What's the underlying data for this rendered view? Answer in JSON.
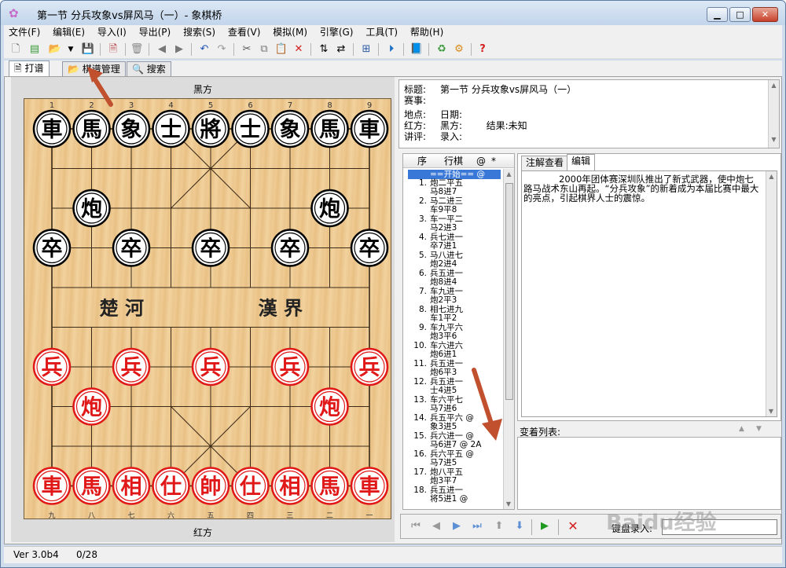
{
  "window": {
    "title": "第一节  分兵攻象vs屏风马（一）- 象棋桥",
    "minimize": "▁",
    "maximize": "□",
    "close": "✕"
  },
  "menu": [
    "文件(F)",
    "编辑(E)",
    "导入(I)",
    "导出(P)",
    "搜索(S)",
    "查看(V)",
    "模拟(M)",
    "引擎(G)",
    "工具(T)",
    "帮助(H)"
  ],
  "tabs": [
    {
      "label": "打谱",
      "icon": "notepad-icon"
    },
    {
      "label": "棋谱管理",
      "icon": "folder-icon"
    },
    {
      "label": "搜索",
      "icon": "magnifier-icon"
    }
  ],
  "board": {
    "top_label": "黑方",
    "bottom_label": "红方",
    "top_files": [
      "1",
      "2",
      "3",
      "4",
      "5",
      "6",
      "7",
      "8",
      "9"
    ],
    "bottom_files": [
      "九",
      "八",
      "七",
      "六",
      "五",
      "四",
      "三",
      "二",
      "一"
    ],
    "river_left": "楚  河",
    "river_right": "漢  界",
    "pieces": [
      {
        "c": "b",
        "t": "車",
        "f": 0,
        "r": 0
      },
      {
        "c": "b",
        "t": "馬",
        "f": 1,
        "r": 0
      },
      {
        "c": "b",
        "t": "象",
        "f": 2,
        "r": 0
      },
      {
        "c": "b",
        "t": "士",
        "f": 3,
        "r": 0
      },
      {
        "c": "b",
        "t": "將",
        "f": 4,
        "r": 0
      },
      {
        "c": "b",
        "t": "士",
        "f": 5,
        "r": 0
      },
      {
        "c": "b",
        "t": "象",
        "f": 6,
        "r": 0
      },
      {
        "c": "b",
        "t": "馬",
        "f": 7,
        "r": 0
      },
      {
        "c": "b",
        "t": "車",
        "f": 8,
        "r": 0
      },
      {
        "c": "b",
        "t": "炮",
        "f": 1,
        "r": 2
      },
      {
        "c": "b",
        "t": "炮",
        "f": 7,
        "r": 2
      },
      {
        "c": "b",
        "t": "卒",
        "f": 0,
        "r": 3
      },
      {
        "c": "b",
        "t": "卒",
        "f": 2,
        "r": 3
      },
      {
        "c": "b",
        "t": "卒",
        "f": 4,
        "r": 3
      },
      {
        "c": "b",
        "t": "卒",
        "f": 6,
        "r": 3
      },
      {
        "c": "b",
        "t": "卒",
        "f": 8,
        "r": 3
      },
      {
        "c": "r",
        "t": "兵",
        "f": 0,
        "r": 6
      },
      {
        "c": "r",
        "t": "兵",
        "f": 2,
        "r": 6
      },
      {
        "c": "r",
        "t": "兵",
        "f": 4,
        "r": 6
      },
      {
        "c": "r",
        "t": "兵",
        "f": 6,
        "r": 6
      },
      {
        "c": "r",
        "t": "兵",
        "f": 8,
        "r": 6
      },
      {
        "c": "r",
        "t": "炮",
        "f": 1,
        "r": 7
      },
      {
        "c": "r",
        "t": "炮",
        "f": 7,
        "r": 7
      },
      {
        "c": "r",
        "t": "車",
        "f": 0,
        "r": 9
      },
      {
        "c": "r",
        "t": "馬",
        "f": 1,
        "r": 9
      },
      {
        "c": "r",
        "t": "相",
        "f": 2,
        "r": 9
      },
      {
        "c": "r",
        "t": "仕",
        "f": 3,
        "r": 9
      },
      {
        "c": "r",
        "t": "帥",
        "f": 4,
        "r": 9
      },
      {
        "c": "r",
        "t": "仕",
        "f": 5,
        "r": 9
      },
      {
        "c": "r",
        "t": "相",
        "f": 6,
        "r": 9
      },
      {
        "c": "r",
        "t": "馬",
        "f": 7,
        "r": 9
      },
      {
        "c": "r",
        "t": "車",
        "f": 8,
        "r": 9
      }
    ]
  },
  "info": {
    "title_label": "标题:",
    "title_value": "第一节  分兵攻象vs屏风马（一）",
    "event_label": "赛事:",
    "place_label": "地点:",
    "date_label": "日期:",
    "red_label": "红方:",
    "black_label": "黑方:",
    "result_label": "结果:",
    "result_value": "未知",
    "commentator_label": "讲评:",
    "recorder_label": "录入:"
  },
  "moves": {
    "col_seq": "序",
    "col_move": "行棋",
    "col_at": "@",
    "col_star": "*",
    "start": "==开始== @",
    "list": [
      {
        "n": "1.",
        "r": "炮二平五",
        "b": "马8进7"
      },
      {
        "n": "2.",
        "r": "马二进三",
        "b": "车9平8"
      },
      {
        "n": "3.",
        "r": "车一平二",
        "b": "马2进3"
      },
      {
        "n": "4.",
        "r": "兵七进一",
        "b": "卒7进1"
      },
      {
        "n": "5.",
        "r": "马八进七",
        "b": "炮2进4"
      },
      {
        "n": "6.",
        "r": "兵五进一",
        "b": "炮8进4"
      },
      {
        "n": "7.",
        "r": "车九进一",
        "b": "炮2平3"
      },
      {
        "n": "8.",
        "r": "相七进九",
        "b": "车1平2"
      },
      {
        "n": "9.",
        "r": "车九平六",
        "b": "炮3平6"
      },
      {
        "n": "10.",
        "r": "车六进六",
        "b": "炮6进1"
      },
      {
        "n": "11.",
        "r": "兵五进一",
        "b": "炮6平3"
      },
      {
        "n": "12.",
        "r": "兵五进一",
        "b": "士4进5"
      },
      {
        "n": "13.",
        "r": "车六平七",
        "b": "马7进6"
      },
      {
        "n": "14.",
        "r": "兵五平六 @",
        "b": "象3进5"
      },
      {
        "n": "15.",
        "r": "兵六进一 @",
        "b": "马6进7 @ 2A"
      },
      {
        "n": "16.",
        "r": "兵六平五 @",
        "b": "马7进5"
      },
      {
        "n": "17.",
        "r": "炮八平五",
        "b": "炮3平7"
      },
      {
        "n": "18.",
        "r": "兵五进一",
        "b": "将5进1 @"
      }
    ]
  },
  "notes": {
    "tab_view": "注解查看",
    "tab_edit": "编辑",
    "text": "2000年团体赛深圳队推出了新式武器，使中炮七路马战术东山再起。“分兵攻象”的新着成为本届比赛中最大的亮点，引起棋界人士的震惊。"
  },
  "variations": {
    "label": "变着列表:"
  },
  "nav": {
    "record_label": "键盘录入:"
  },
  "status": {
    "version": "Ver 3.0b4",
    "progress": "0/28"
  },
  "watermark": "Baidu经验",
  "colors": {
    "red": "#e01818",
    "black": "#000000",
    "accent_arrow": "#c0502e"
  }
}
